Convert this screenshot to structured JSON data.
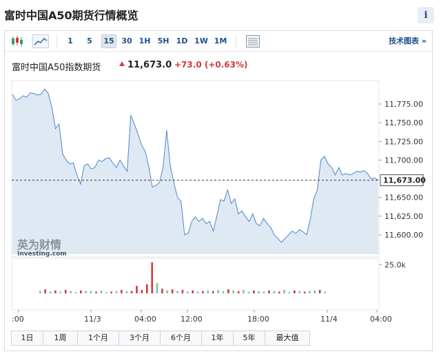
{
  "page": {
    "title": "富时中国A50期货行情概览",
    "info_icon": "i"
  },
  "toolbar": {
    "candle_icon": "candlestick-icon",
    "area_icon": "area-chart-icon",
    "intervals": [
      "1",
      "5",
      "15",
      "30",
      "1H",
      "5H",
      "1D",
      "1W",
      "1M"
    ],
    "active_interval": "15",
    "table_icon": "data-table-icon",
    "tech_link": "技术图表 »"
  },
  "instrument": {
    "name": "富时中国A50指数期货",
    "price": "11,673.0",
    "change": "+73.0 (+0.63%)"
  },
  "watermark": {
    "line1": "英为财情",
    "line2": "Investing.com"
  },
  "colors": {
    "line": "#5b8fc9",
    "area": "#dfe9f4",
    "up": "#d23a3a",
    "down": "#7dbfa6",
    "accent": "#1d4f8f"
  },
  "range_buttons": [
    "1日",
    "1周",
    "1个月",
    "3个月",
    "6个月",
    "1年",
    "5年",
    "最大值"
  ],
  "chart_data": {
    "type": "area",
    "price_axis": {
      "ticks": [
        11775,
        11750,
        11725,
        11700,
        11650,
        11625,
        11600
      ],
      "tick_labels": [
        "11,775.00",
        "11,750.00",
        "11,725.00",
        "11,700.00",
        "11,650.00",
        "11,625.00",
        "11,600.00"
      ]
    },
    "current_price_label": "11,673.00",
    "current_price": 11673,
    "volume_axis": {
      "tick_labels": [
        "25.0k"
      ],
      "ticks": [
        25000
      ]
    },
    "time_labels": [
      ":00",
      "11/3",
      "04:00",
      "12:00",
      "18:00",
      "11/4",
      "04:00"
    ],
    "series": [
      {
        "values": [
          11788,
          11780,
          11782,
          11786,
          11784,
          11790,
          11789,
          11787,
          11788,
          11795,
          11789,
          11770,
          11742,
          11748,
          11708,
          11700,
          11695,
          11696,
          11680,
          11668,
          11692,
          11695,
          11688,
          11690,
          11700,
          11698,
          11702,
          11703,
          11696,
          11690,
          11700,
          11692,
          11685,
          11760,
          11748,
          11735,
          11720,
          11712,
          11692,
          11664,
          11666,
          11670,
          11690,
          11740,
          11692,
          11670,
          11650,
          11645,
          11600,
          11602,
          11618,
          11624,
          11618,
          11622,
          11615,
          11618,
          11605,
          11625,
          11647,
          11645,
          11660,
          11642,
          11648,
          11628,
          11632,
          11624,
          11618,
          11628,
          11615,
          11612,
          11622,
          11615,
          11610,
          11600,
          11595,
          11590,
          11595,
          11600,
          11605,
          11602,
          11607,
          11604,
          11600,
          11620,
          11648,
          11660,
          11700,
          11705,
          11695,
          11690,
          11680,
          11690,
          11680,
          11682,
          11680,
          11682,
          11685,
          11684,
          11686,
          11682,
          11675,
          11676,
          11673
        ]
      }
    ],
    "volume": {
      "values": [
        2000,
        3500,
        1500,
        2500,
        1500,
        3000,
        2000,
        1000,
        2500,
        2000,
        2000,
        1500,
        2500,
        1000,
        1500,
        2000,
        3000,
        1800,
        2000,
        6500,
        3000,
        8000,
        27000,
        9000,
        4000,
        2500,
        3500,
        2000,
        3000,
        1500,
        2500,
        1500,
        2000,
        2500,
        2000,
        3000,
        2000,
        3500,
        2500,
        2000,
        3000,
        1500,
        2500,
        2000,
        1500,
        2500,
        2000,
        1500,
        3000,
        1000,
        2500,
        2000,
        1500,
        2000,
        2500,
        3000,
        1500
      ],
      "up": [
        false,
        true,
        false,
        true,
        false,
        true,
        false,
        false,
        true,
        false,
        false,
        true,
        false,
        false,
        true,
        false,
        true,
        false,
        true,
        true,
        true,
        true,
        true,
        false,
        true,
        false,
        true,
        false,
        true,
        false,
        true,
        false,
        true,
        false,
        true,
        false,
        false,
        true,
        false,
        true,
        false,
        false,
        true,
        false,
        false,
        true,
        false,
        true,
        false,
        false,
        true,
        false,
        true,
        false,
        false,
        true,
        false
      ]
    }
  }
}
